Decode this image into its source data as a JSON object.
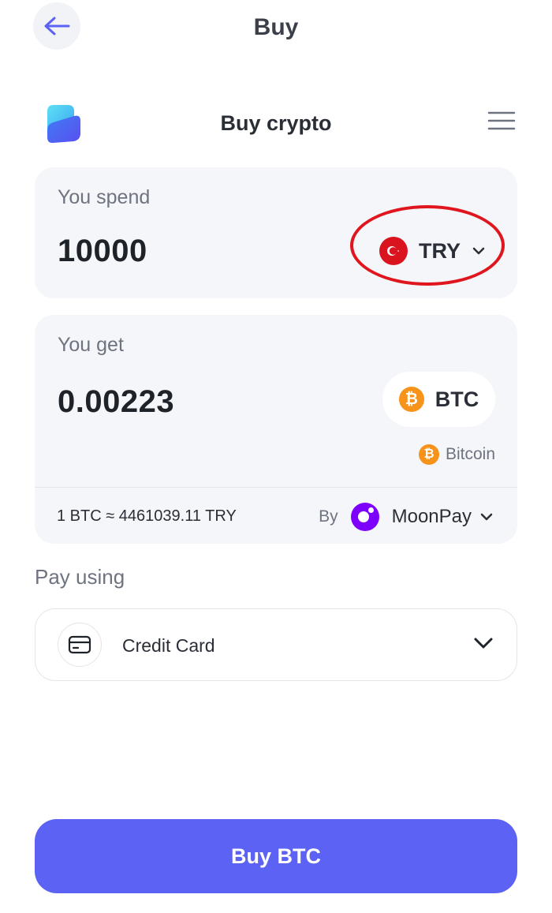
{
  "header": {
    "title": "Buy"
  },
  "widget": {
    "title": "Buy crypto"
  },
  "spend": {
    "label": "You spend",
    "amount": "10000",
    "currency": "TRY"
  },
  "get": {
    "label": "You get",
    "amount": "0.00223",
    "asset_code": "BTC",
    "asset_name": "Bitcoin",
    "asset_symbol": "₿"
  },
  "rate": {
    "text": "1 BTC ≈ 4461039.11 TRY"
  },
  "provider": {
    "by_label": "By",
    "name": "MoonPay"
  },
  "payment": {
    "section_label": "Pay using",
    "method": "Credit Card"
  },
  "cta": {
    "label": "Buy BTC"
  },
  "colors": {
    "accent": "#5b62f4",
    "highlight": "#e0161e",
    "bitcoin": "#f7931a",
    "moonpay": "#7d00ff",
    "card_bg": "#f5f6f9"
  },
  "icons": {
    "back": "arrow-left-icon",
    "brand": "logo-icon",
    "menu": "hamburger-menu-icon",
    "currency_flag": "turkey-flag-icon",
    "asset": "bitcoin-icon",
    "provider": "moonpay-logo-icon",
    "payment": "credit-card-icon",
    "dropdown": "chevron-down-icon"
  }
}
